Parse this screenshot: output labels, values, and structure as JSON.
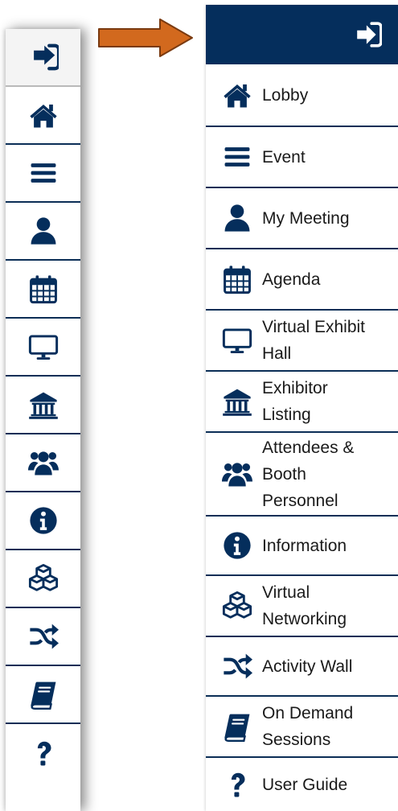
{
  "colors": {
    "navy": "#052e5c",
    "arrow": "#d2691e",
    "divider": "#0b2e56"
  },
  "collapsed_sidebar": {
    "items": [
      {
        "icon": "sign-out-icon"
      },
      {
        "icon": "home-icon"
      },
      {
        "icon": "bars-icon"
      },
      {
        "icon": "user-icon"
      },
      {
        "icon": "calendar-icon"
      },
      {
        "icon": "monitor-icon"
      },
      {
        "icon": "bank-icon"
      },
      {
        "icon": "users-icon"
      },
      {
        "icon": "info-icon"
      },
      {
        "icon": "cubes-icon"
      },
      {
        "icon": "random-icon"
      },
      {
        "icon": "book-icon"
      },
      {
        "icon": "question-icon"
      }
    ]
  },
  "expanded_sidebar": {
    "header_icon": "sign-in-icon",
    "items": [
      {
        "icon": "home-icon",
        "label": "Lobby"
      },
      {
        "icon": "bars-icon",
        "label": "Event"
      },
      {
        "icon": "user-icon",
        "label": "My Meeting"
      },
      {
        "icon": "calendar-icon",
        "label": "Agenda"
      },
      {
        "icon": "monitor-icon",
        "label": "Virtual Exhibit\nHall"
      },
      {
        "icon": "bank-icon",
        "label": "Exhibitor\nListing"
      },
      {
        "icon": "users-icon",
        "label": "Attendees &\nBooth\nPersonnel"
      },
      {
        "icon": "info-icon",
        "label": "Information"
      },
      {
        "icon": "cubes-icon",
        "label": "Virtual\nNetworking"
      },
      {
        "icon": "random-icon",
        "label": "Activity Wall"
      },
      {
        "icon": "book-icon",
        "label": "On Demand\nSessions"
      },
      {
        "icon": "question-icon",
        "label": "User Guide"
      }
    ]
  }
}
